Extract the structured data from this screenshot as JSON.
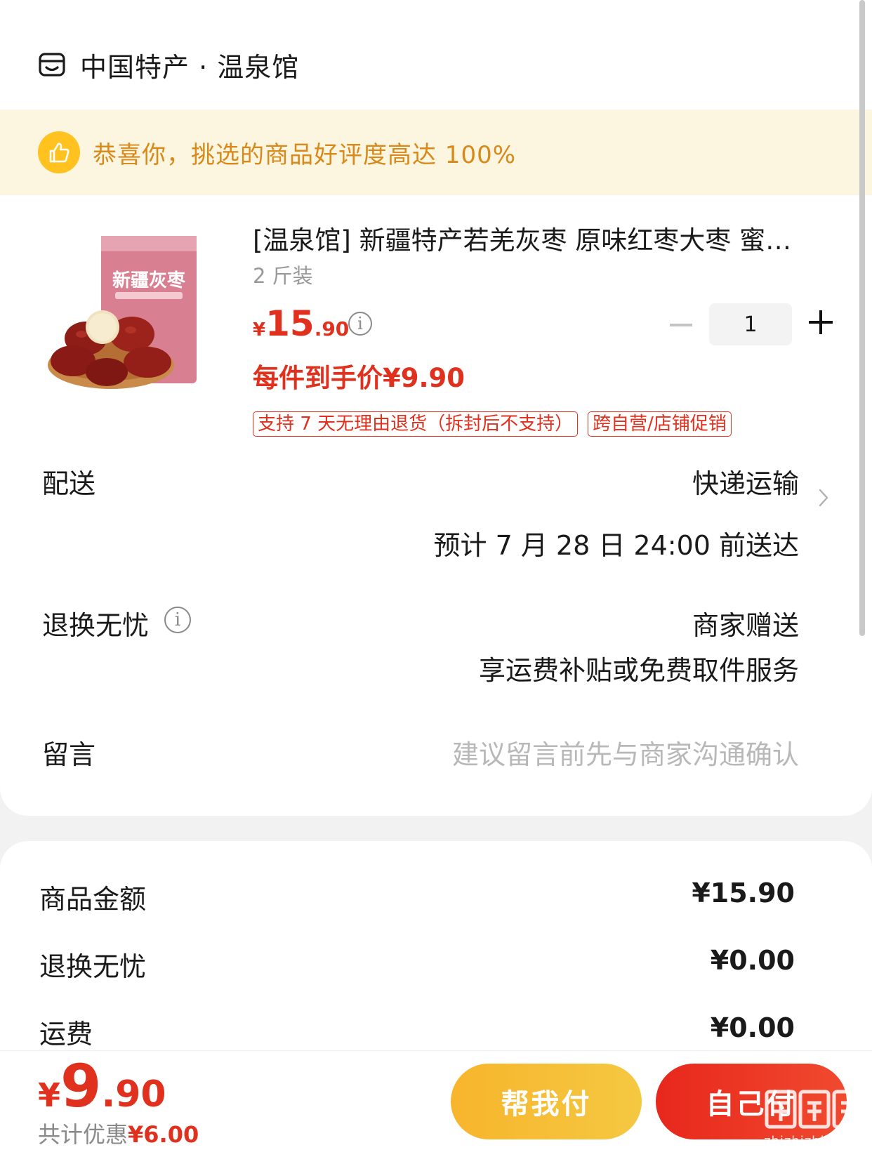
{
  "shop": {
    "name": "中国特产 · 温泉馆",
    "icon": "shop-icon"
  },
  "banner": {
    "text": "恭喜你，挑选的商品好评度高达 100%",
    "icon": "thumbs-up-icon"
  },
  "product": {
    "title": "[温泉馆] 新疆特产若羌灰枣 原味红枣大枣 蜜…",
    "spec": "2 斤装",
    "price_symbol": "¥",
    "price_integer": "15",
    "price_decimal": ".90",
    "unit_price": "每件到手价¥9.90",
    "quantity": "1",
    "tags": [
      "支持 7 天无理由退货（拆封后不支持）",
      "跨自营/店铺促销"
    ],
    "image_label": "新疆灰枣"
  },
  "delivery": {
    "label": "配送",
    "method": "快递运输",
    "eta": "预计 7 月 28 日 24:00 前送达"
  },
  "returns": {
    "label": "退换无忧",
    "value": "商家赠送",
    "detail": "享运费补贴或免费取件服务"
  },
  "message": {
    "label": "留言",
    "placeholder": "建议留言前先与商家沟通确认"
  },
  "summary": [
    {
      "label": "商品金额",
      "value": "¥15.90"
    },
    {
      "label": "退换无忧",
      "value": "¥0.00"
    },
    {
      "label": "运费",
      "value": "¥0.00"
    }
  ],
  "footer": {
    "total_symbol": "¥",
    "total_integer": "9",
    "total_decimal": ".90",
    "discount_label": "共计优惠",
    "discount_value": "¥6.00",
    "help_pay_label": "帮我付",
    "self_pay_label": "自己付"
  },
  "watermark": {
    "text": "zhizhizhi.com"
  },
  "colors": {
    "accent_red": "#e0301e",
    "banner_bg": "#fcf5df",
    "banner_text": "#d8891a",
    "help_btn": "#f7b52c"
  }
}
